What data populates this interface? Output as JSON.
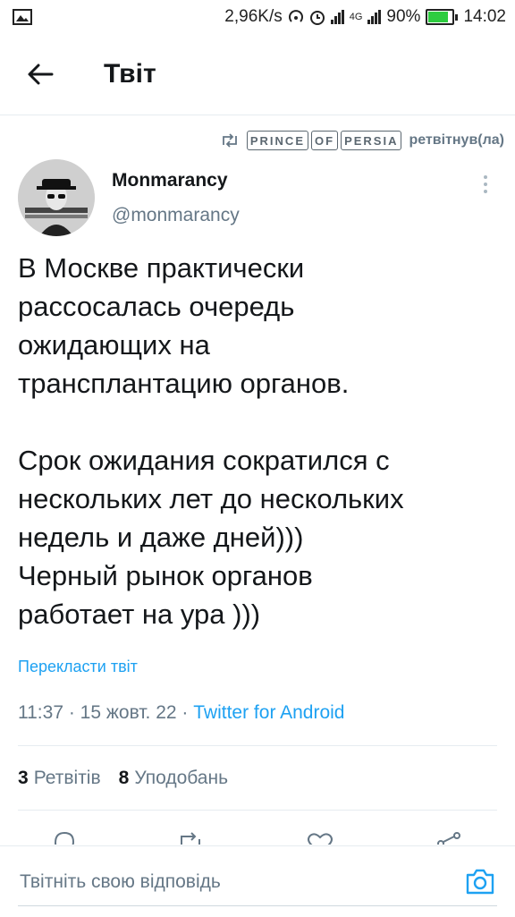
{
  "status_bar": {
    "network_speed": "2,96K/s",
    "network_type": "4G",
    "battery": "90%",
    "battery_level": 0.9,
    "time": "14:02"
  },
  "header": {
    "title": "Твіт"
  },
  "retweet": {
    "retweeter_tiles": [
      "PRINCE",
      "OF",
      "PERSIA"
    ],
    "label": "ретвітнув(ла)"
  },
  "author": {
    "name": "Monmarancy",
    "handle": "@monmarancy"
  },
  "tweet": {
    "text": "В Москве практически\nрассосалась очередь\nожидающих на\nтрансплантацию органов.\n\nСрок ожидания сократился с\nнескольких лет до нескольких\nнедель и даже дней)))\nЧерный рынок органов\nработает на ура )))",
    "translate_label": "Перекласти твіт",
    "meta_prefix": "11:37 · 15 жовт. 22 · ",
    "source": "Twitter for Android"
  },
  "stats": {
    "retweets_count": "3",
    "retweets_label": "Ретвітів",
    "likes_count": "8",
    "likes_label": "Уподобань"
  },
  "reply": {
    "placeholder": "Твітніть свою відповідь"
  },
  "colors": {
    "accent": "#1da1f2",
    "secondary_text": "#657786",
    "battery": "#2ecc40"
  }
}
